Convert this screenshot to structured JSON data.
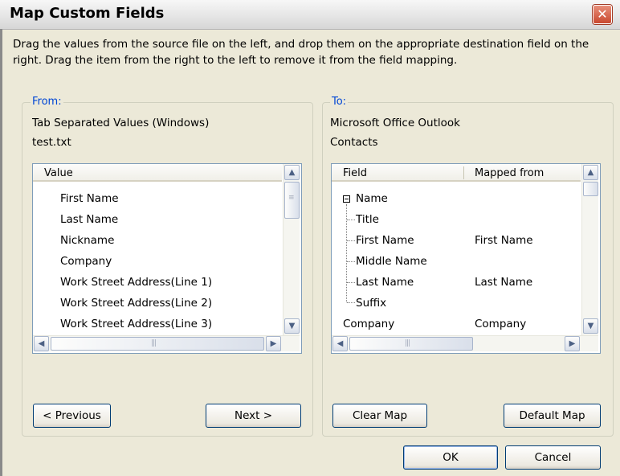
{
  "window": {
    "title": "Map Custom Fields",
    "close_glyph": "✕"
  },
  "instructions": "Drag the values from the source file on the left, and drop them on the appropriate destination field on the right.  Drag the item from the right to the left to remove it from the field mapping.",
  "from": {
    "legend": "From:",
    "source_type": "Tab Separated Values (Windows)",
    "source_file": "test.txt",
    "header": "Value",
    "items": [
      "First Name",
      "Last Name",
      "Nickname",
      "Company",
      "Work Street Address(Line 1)",
      "Work Street Address(Line 2)",
      "Work Street Address(Line 3)"
    ],
    "previous_button": "< Previous",
    "next_button": "Next >"
  },
  "to": {
    "legend": "To:",
    "destination_app": "Microsoft Office Outlook",
    "destination_folder": "Contacts",
    "headers": {
      "field": "Field",
      "mapped_from": "Mapped from"
    },
    "group": "Name",
    "fields": [
      {
        "field": "Title",
        "mapped_from": ""
      },
      {
        "field": "First Name",
        "mapped_from": "First Name"
      },
      {
        "field": "Middle Name",
        "mapped_from": ""
      },
      {
        "field": "Last Name",
        "mapped_from": "Last Name"
      },
      {
        "field": "Suffix",
        "mapped_from": ""
      }
    ],
    "next_row": {
      "field": "Company",
      "mapped_from": "Company"
    },
    "clear_map_button": "Clear Map",
    "default_map_button": "Default Map"
  },
  "footer": {
    "ok_button": "OK",
    "cancel_button": "Cancel"
  },
  "icons": {
    "scroll_up": "up-arrow-icon",
    "scroll_down": "down-arrow-icon",
    "scroll_left": "left-arrow-icon",
    "scroll_right": "right-arrow-icon",
    "expander": "collapse-minus-icon",
    "close": "close-icon"
  },
  "colors": {
    "dialog_bg": "#ece9d8",
    "legend_text": "#0046d5",
    "close_button": "#c9482f",
    "list_border": "#7f9db9"
  }
}
